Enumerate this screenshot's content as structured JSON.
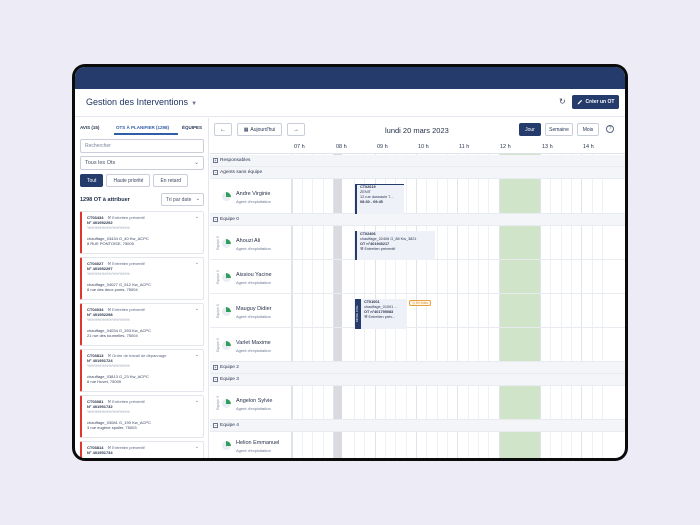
{
  "app": {
    "title": "Gestion des Interventions",
    "create_label": "Créer un OT"
  },
  "left": {
    "tabs": [
      {
        "label": "AVIS (15)"
      },
      {
        "label": "OTS À PLANIFIER (1298)"
      },
      {
        "label": "ÉQUIPES"
      }
    ],
    "search_placeholder": "Rechercher",
    "filter_select": "Tous les Ots",
    "chips": [
      {
        "label": "Tout"
      },
      {
        "label": "Haute priorité"
      },
      {
        "label": "En retard"
      }
    ],
    "count_label": "1298 OT à attribuer",
    "sort_label": "Tri par date",
    "cards": [
      {
        "code": "CT03434",
        "type": "Entretien préventif",
        "number": "N° 401952292",
        "phone": "%%%%%%%%%%%%",
        "location": "chauffage_03434 G_40 Kw_ACPC",
        "address": "8 RUE PONTOISE, 75005"
      },
      {
        "code": "CT04027",
        "type": "Entretien préventif",
        "number": "N° 401952297",
        "phone": "%%%%%%%%%%%%",
        "location": "chauffage_04027 G_512 Kw_ACPC",
        "address": "8 rue des deux ponts, 75004"
      },
      {
        "code": "CT04034",
        "type": "Entretien préventif",
        "number": "N° 401952298",
        "phone": "%%%%%%%%%%%%",
        "location": "chauffage_04034 G_393 Kw_ACPC",
        "address": "21 rue des tournelles, 75004"
      },
      {
        "code": "CT03813",
        "type": "Ordre de travail de dépannage",
        "number": "N° 401951724",
        "phone": "%%%%%%%%%%%%",
        "location": "chauffage_03813 G_23 Kw_ACPC",
        "address": "8 rue Huvet, 75009"
      },
      {
        "code": "CT03081",
        "type": "Entretien préventif",
        "number": "N° 401951732",
        "phone": "%%%%%%%%%%%%",
        "location": "chauffage_03081 G_190 Kw_ACPC",
        "address": "3 rue eugène spuller, 75003"
      },
      {
        "code": "CT03814",
        "type": "Entretien préventif",
        "number": "N° 401951734",
        "phone": "",
        "location": "",
        "address": ""
      }
    ]
  },
  "planning": {
    "today_label": "Aujourd'hui",
    "date_title": "lundi 20 mars 2023",
    "views": [
      {
        "label": "Jour",
        "active": true
      },
      {
        "label": "Semaine",
        "active": false
      },
      {
        "label": "Mois",
        "active": false
      }
    ],
    "help_label": "?",
    "hours": [
      "07 h",
      "08 h",
      "09 h",
      "10 h",
      "11 h",
      "12 h",
      "13 h",
      "14 h"
    ],
    "groups": {
      "responsables": "Responsables",
      "agents_sans_equipe": "Agents sans équipe",
      "equipe0": "Equipe 0",
      "equipe2": "Equipe 2",
      "equipe3": "Equipe 3",
      "equipe4": "Equipe 4"
    },
    "resources": [
      {
        "name": "Andre Virginie",
        "role": "Agent d'exploitation",
        "tag": ""
      },
      {
        "name": "Ahouzi Ali",
        "role": "Agent d'exploitation",
        "tag": "Equipe 0"
      },
      {
        "name": "Aissiou Yacine",
        "role": "Agent d'exploitation",
        "tag": "Equipe 0"
      },
      {
        "name": "Mauguy Didier",
        "role": "Agent d'exploitation",
        "tag": "Equipe 0"
      },
      {
        "name": "Varlet Maxime",
        "role": "Agent d'exploitation",
        "tag": "Equipe 0"
      },
      {
        "name": "Angelon Sylvie",
        "role": "Agent d'exploitation",
        "tag": "Equipe 3"
      },
      {
        "name": "Helion Emmanuel",
        "role": "Agent d'exploitation",
        "tag": ""
      }
    ],
    "events": [
      {
        "code": "CT02619",
        "line1": "ZENIT",
        "line2": "12 rue duseaule 7...",
        "time": "08:30 - 09:45"
      },
      {
        "code": "CT02406",
        "line1": "chauffage_02406 G_88 Kw_3821",
        "number": "OT n°401940217",
        "type": "Entretien préventif"
      },
      {
        "code": "CT01001",
        "line1": "chauffage_01001 ...",
        "number": "OT n°401795083",
        "type": "Entretien prév...",
        "tag": "En frais",
        "side": "MODE FIXE"
      }
    ]
  },
  "colors": {
    "brand": "#243b6b",
    "accent": "#2f5ea8",
    "priority": "#e0342f",
    "lunch": "#cfe4c9"
  }
}
